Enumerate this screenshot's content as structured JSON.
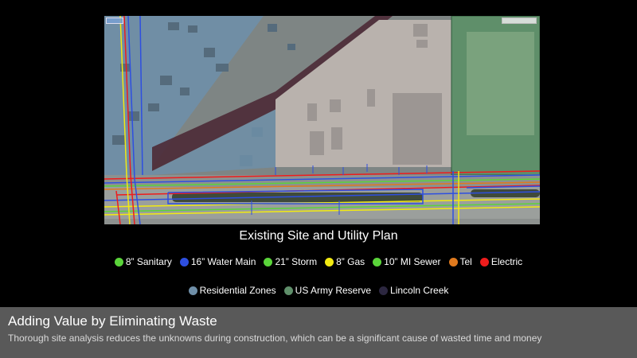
{
  "map": {
    "title": "Existing Site and Utility Plan"
  },
  "legend": {
    "utilities": [
      {
        "label": "8” Sanitary",
        "color": "#5ad43a",
        "icon": "green-circle-icon"
      },
      {
        "label": "16” Water Main",
        "color": "#2e4fe0",
        "icon": "blue-circle-icon"
      },
      {
        "label": "21” Storm",
        "color": "#5ad43a",
        "icon": "green-circle-icon"
      },
      {
        "label": "8” Gas",
        "color": "#f2ea12",
        "icon": "yellow-circle-icon"
      },
      {
        "label": "10” MI Sewer",
        "color": "#5ad43a",
        "icon": "green-circle-icon"
      },
      {
        "label": "Tel",
        "color": "#e07a1e",
        "icon": "orange-circle-icon"
      },
      {
        "label": "Electric",
        "color": "#ee1c1c",
        "icon": "red-circle-icon"
      }
    ],
    "zones": [
      {
        "label": "Residential Zones",
        "color": "#6f8fa8",
        "icon": "slate-blue-circle-icon"
      },
      {
        "label": "US Army Reserve",
        "color": "#5f8f6a",
        "icon": "green-gray-circle-icon"
      },
      {
        "label": "Lincoln Creek",
        "color": "#2c2740",
        "icon": "dark-purple-circle-icon"
      }
    ]
  },
  "footer": {
    "title": "Adding Value by Eliminating Waste",
    "subtitle": "Thorough site analysis reduces the unknowns during construction, which can be a significant cause of wasted time and money"
  }
}
